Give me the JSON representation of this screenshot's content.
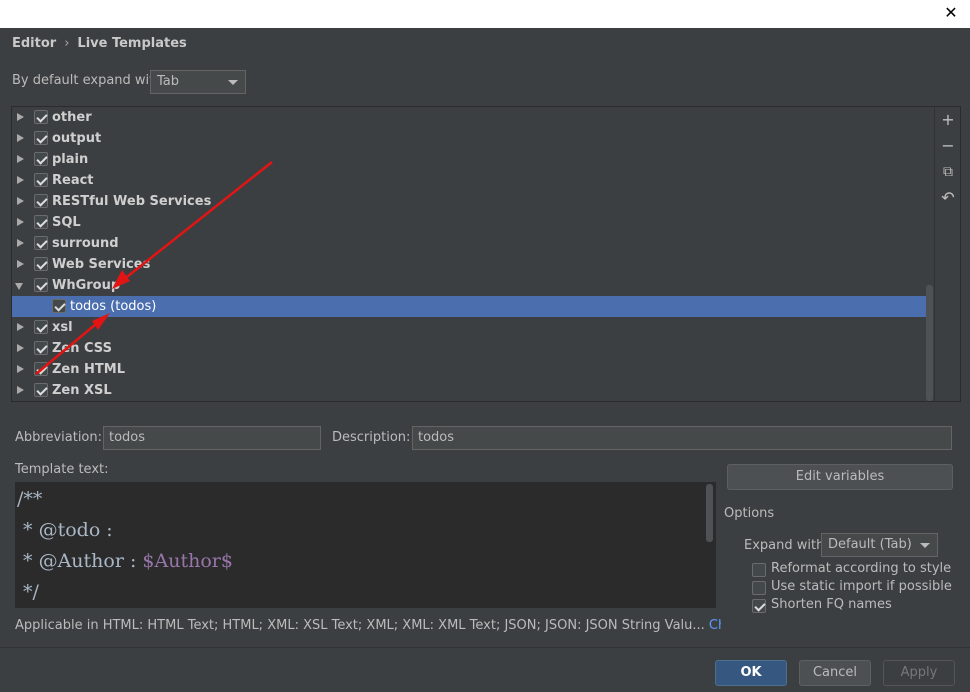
{
  "window": {
    "close_glyph": "✕"
  },
  "breadcrumb": {
    "parent": "Editor",
    "separator": "›",
    "current": "Live Templates"
  },
  "expand": {
    "label": "By default expand with",
    "value": "Tab"
  },
  "tree": {
    "items": [
      {
        "label": "other",
        "checked": true,
        "expanded": false
      },
      {
        "label": "output",
        "checked": true,
        "expanded": false
      },
      {
        "label": "plain",
        "checked": true,
        "expanded": false
      },
      {
        "label": "React",
        "checked": true,
        "expanded": false
      },
      {
        "label": "RESTful Web Services",
        "checked": true,
        "expanded": false
      },
      {
        "label": "SQL",
        "checked": true,
        "expanded": false
      },
      {
        "label": "surround",
        "checked": true,
        "expanded": false
      },
      {
        "label": "Web Services",
        "checked": true,
        "expanded": false
      },
      {
        "label": "WhGroup",
        "checked": true,
        "expanded": true
      },
      {
        "label": "todos (todos)",
        "checked": true,
        "child": true,
        "selected": true
      },
      {
        "label": "xsl",
        "checked": true,
        "expanded": false
      },
      {
        "label": "Zen CSS",
        "checked": true,
        "expanded": false
      },
      {
        "label": "Zen HTML",
        "checked": true,
        "expanded": false
      },
      {
        "label": "Zen XSL",
        "checked": true,
        "expanded": false
      }
    ]
  },
  "toolbar": {
    "add": "+",
    "remove": "−",
    "copy": "⧉",
    "restore": "↶"
  },
  "details": {
    "abbreviation_label": "Abbreviation:",
    "abbreviation_value": "todos",
    "description_label": "Description:",
    "description_value": "todos",
    "template_label": "Template text:"
  },
  "template": {
    "line1": "/**",
    "line2": " * @todo :",
    "line3_prefix": " * @Author : ",
    "line3_var": "$Author$",
    "line4": " */"
  },
  "edit_variables": "Edit variables",
  "options": {
    "title": "Options",
    "expand_label": "Expand with",
    "expand_value": "Default (Tab)",
    "reformat": {
      "label": "Reformat according to style",
      "checked": false
    },
    "static_import": {
      "label": "Use static import if possible",
      "checked": false
    },
    "shorten_fq": {
      "label": "Shorten FQ names",
      "checked": true
    }
  },
  "applicable": {
    "text": "Applicable in HTML: HTML Text; HTML; XML: XSL Text; XML; XML: XML Text; JSON; JSON: JSON String Valu...",
    "change": "Change",
    "change_caret": "⌄"
  },
  "buttons": {
    "ok": "OK",
    "cancel": "Cancel",
    "apply": "Apply"
  },
  "colors": {
    "accent": "#4b6eaf",
    "primary_button": "#365880",
    "annotation_arrow": "#e31414",
    "template_variable": "#9876aa"
  }
}
